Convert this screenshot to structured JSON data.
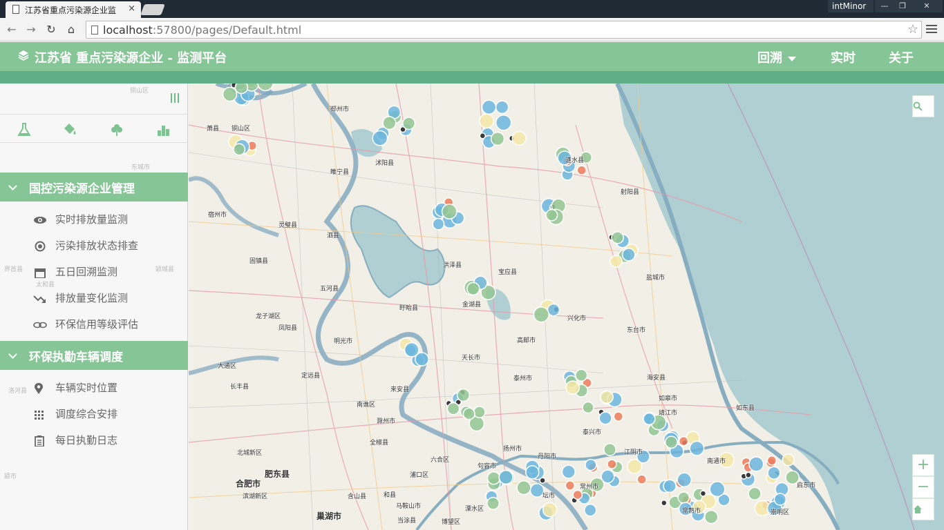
{
  "browser": {
    "tab_title": "江苏省重点污染源企业监",
    "profile": "intMinor",
    "url_host": "localhost",
    "url_rest": ":57800/pages/Default.html"
  },
  "header": {
    "title": "江苏省 重点污染源企业 - 监测平台",
    "nav": [
      "回溯",
      "实时",
      "关于"
    ]
  },
  "sidebar": {
    "tools": [
      "flask-icon",
      "paint-bucket-icon",
      "tree-icon",
      "bar-chart-icon"
    ],
    "sections": [
      {
        "title": "国控污染源企业管理",
        "items": [
          "实时排放量监测",
          "污染排放状态排查",
          "五日回溯监测",
          "排放量变化监测",
          "环保信用等级评估"
        ]
      },
      {
        "title": "环保执勤车辆调度",
        "items": [
          "车辆实时位置",
          "调度综合安排",
          "每日执勤日志"
        ]
      }
    ]
  },
  "map": {
    "labels": [
      "邳州市",
      "萧县",
      "铜山区",
      "睢宁县",
      "沭阳县",
      "涟水县",
      "射阳县",
      "宿州市",
      "灵璧县",
      "泗县",
      "洪泽县",
      "宝应县",
      "盐城市",
      "固镇县",
      "五河县",
      "盱眙县",
      "金湖县",
      "兴化市",
      "东台市",
      "龙子湖区",
      "凤阳县",
      "明光市",
      "高邮市",
      "天长市",
      "海安县",
      "如东县",
      "定远县",
      "来安县",
      "南谯区",
      "滁州市",
      "扬州市",
      "泰兴市",
      "如皋市",
      "全椒县",
      "长丰县",
      "大通区",
      "北城新区",
      "肥东县",
      "合肥市",
      "滨湖新区",
      "含山县",
      "和县",
      "马鞍山市",
      "巢湖市",
      "当涂县",
      "博望区",
      "溧水区",
      "句容市",
      "丹阳市",
      "江阴市",
      "常熟市",
      "常州市",
      "坛市",
      "崇明区",
      "启东市",
      "南通市",
      "泰州市",
      "靖江市",
      "六合区",
      "浦口区"
    ],
    "controls": [
      "+",
      "−"
    ],
    "colors": {
      "blue": "#6cb6dd",
      "green": "#93c592",
      "yellow": "#f4e7a6",
      "red": "#ec7c5c",
      "dark": "#3a3a3a",
      "water": "#afcfd3",
      "land": "#f1efe6"
    }
  }
}
